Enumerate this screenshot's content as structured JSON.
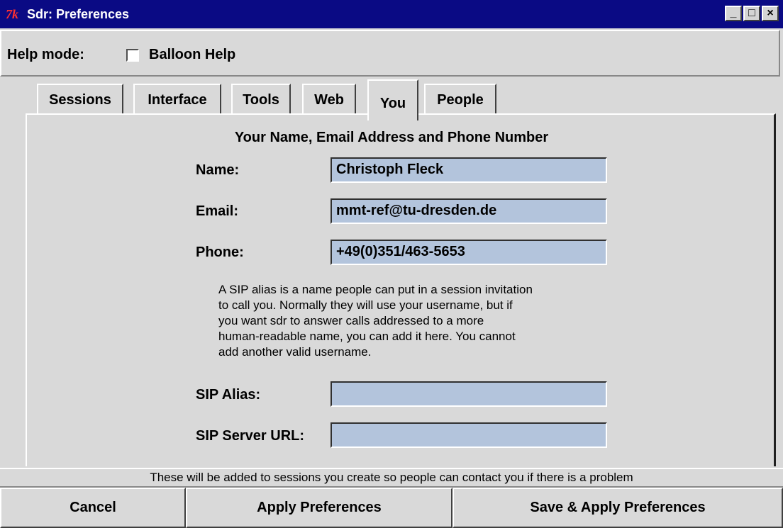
{
  "window": {
    "logo_text": "7k",
    "title": "Sdr: Preferences",
    "minimize_glyph": "_",
    "maximize_glyph": "□",
    "close_glyph": "×"
  },
  "help": {
    "label": "Help mode:",
    "balloon_label": "Balloon Help",
    "balloon_checked": false
  },
  "tabs": [
    {
      "label": "Sessions"
    },
    {
      "label": "Interface"
    },
    {
      "label": "Tools"
    },
    {
      "label": "Web"
    },
    {
      "label": "You",
      "active": true
    },
    {
      "label": "People"
    }
  ],
  "panel": {
    "title": "Your Name, Email Address and Phone Number",
    "fields": {
      "name_label": "Name:",
      "name_value": "Christoph Fleck",
      "email_label": "Email:",
      "email_value": "mmt-ref@tu-dresden.de",
      "phone_label": "Phone:",
      "phone_value": "+49(0)351/463-5653",
      "sip_alias_label": "SIP Alias:",
      "sip_alias_value": "",
      "sip_server_label": "SIP Server URL:",
      "sip_server_value": ""
    },
    "description_lines": [
      "A SIP alias is a name people can put in a session invitation",
      "to call you.  Normally they will use your username, but if",
      "you want sdr to answer calls addressed to a more",
      "human-readable name, you can add it here.  You cannot",
      "add another valid username."
    ]
  },
  "status_text": "These will be added to sessions you create so people can contact you if there is a problem",
  "buttons": {
    "cancel": "Cancel",
    "apply": "Apply Preferences",
    "save_apply": "Save & Apply Preferences"
  },
  "colors": {
    "titlebar": "#0a0a84",
    "field_bg": "#b3c4dc",
    "window_bg": "#d9d9d9"
  },
  "icons": {
    "app": "tk-feather-icon",
    "minimize": "minimize-icon",
    "maximize": "maximize-icon",
    "close": "close-icon"
  }
}
